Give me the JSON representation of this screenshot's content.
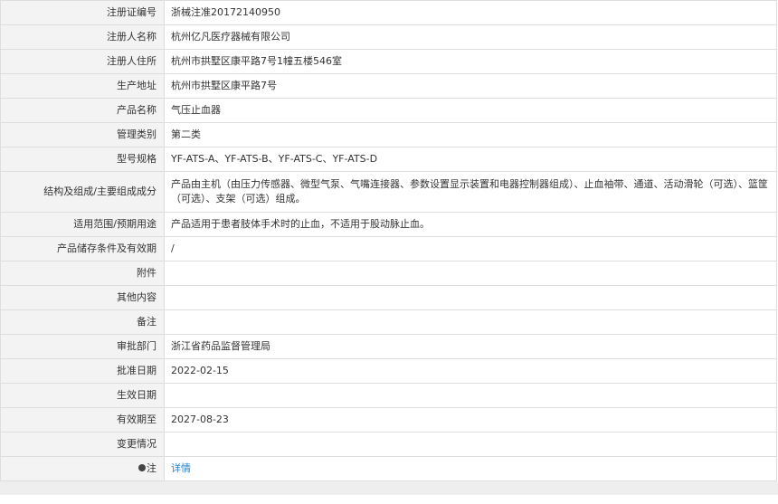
{
  "rows": [
    {
      "label": "注册证编号",
      "value": "浙械注准20172140950"
    },
    {
      "label": "注册人名称",
      "value": "杭州亿凡医疗器械有限公司"
    },
    {
      "label": "注册人住所",
      "value": "杭州市拱墅区康平路7号1幢五楼546室"
    },
    {
      "label": "生产地址",
      "value": "杭州市拱墅区康平路7号"
    },
    {
      "label": "产品名称",
      "value": "气压止血器"
    },
    {
      "label": "管理类别",
      "value": "第二类"
    },
    {
      "label": "型号规格",
      "value": "YF-ATS-A、YF-ATS-B、YF-ATS-C、YF-ATS-D"
    },
    {
      "label": "结构及组成/主要组成成分",
      "value": "产品由主机（由压力传感器、微型气泵、气嘴连接器、参数设置显示装置和电器控制器组成）、止血袖带、通道、活动滑轮（可选）、篮筐（可选）、支架（可选）组成。"
    },
    {
      "label": "适用范围/预期用途",
      "value": "产品适用于患者肢体手术时的止血，不适用于股动脉止血。"
    },
    {
      "label": "产品储存条件及有效期",
      "value": "/"
    },
    {
      "label": "附件",
      "value": ""
    },
    {
      "label": "其他内容",
      "value": ""
    },
    {
      "label": "备注",
      "value": ""
    },
    {
      "label": "审批部门",
      "value": "浙江省药品监督管理局"
    },
    {
      "label": "批准日期",
      "value": "2022-02-15"
    },
    {
      "label": "生效日期",
      "value": ""
    },
    {
      "label": "有效期至",
      "value": "2027-08-23"
    },
    {
      "label": "变更情况",
      "value": ""
    }
  ],
  "note": {
    "label": "注",
    "link_text": "详情",
    "icon": "bulb-icon"
  }
}
